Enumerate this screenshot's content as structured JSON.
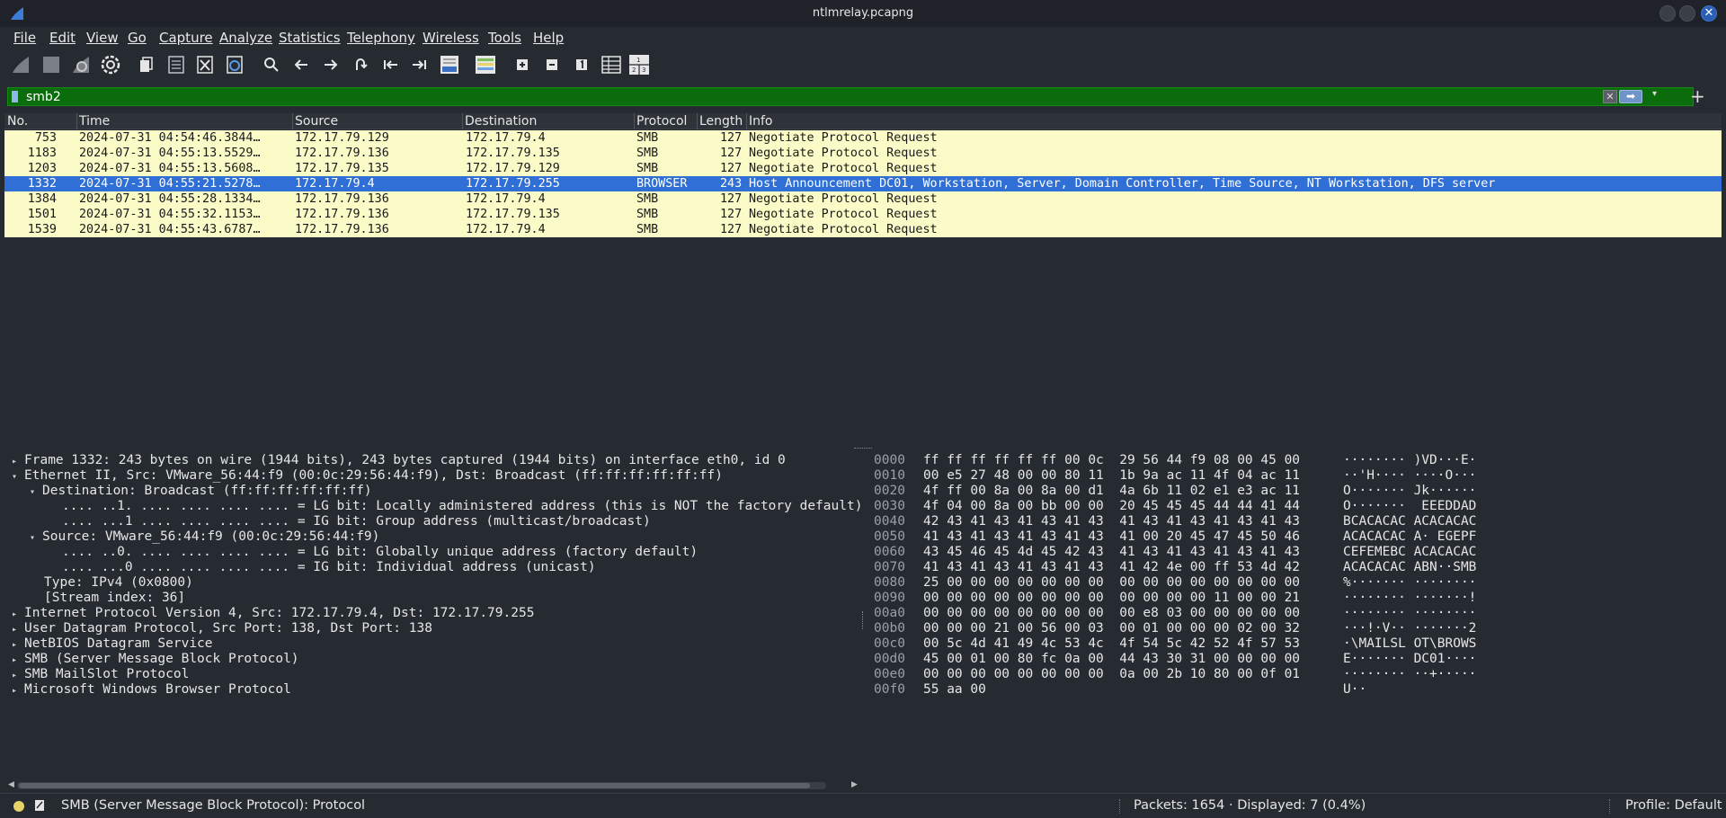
{
  "window": {
    "title": "ntlmrelay.pcapng",
    "app_icon": "wireshark-fin-icon",
    "close_glyph": "✕"
  },
  "menubar": {
    "items": [
      "File",
      "Edit",
      "View",
      "Go",
      "Capture",
      "Analyze",
      "Statistics",
      "Telephony",
      "Wireless",
      "Tools",
      "Help"
    ]
  },
  "toolbar": {
    "icons": [
      "start-capture-icon",
      "stop-capture-icon",
      "restart-capture-icon",
      "capture-options-icon",
      "open-file-icon",
      "save-file-icon",
      "close-file-icon",
      "reload-file-icon",
      "find-packet-icon",
      "go-back-icon",
      "go-forward-icon",
      "go-to-packet-icon",
      "first-packet-icon",
      "last-packet-icon",
      "auto-scroll-icon",
      "colorize-icon",
      "zoom-in-icon",
      "zoom-out-icon",
      "normal-size-icon",
      "resize-columns-icon",
      "layout-icon"
    ],
    "zoom_in_glyph": "+",
    "zoom_out_glyph": "−",
    "normal_size_glyph": "1",
    "layout_glyph": "1 2|3"
  },
  "filter": {
    "value": "smb2",
    "clear_glyph": "✕",
    "apply_glyph": "➡",
    "dropdown_glyph": "▾",
    "add_glyph": "+"
  },
  "packet_list": {
    "columns": [
      "No.",
      "Time",
      "Source",
      "Destination",
      "Protocol",
      "Length",
      "Info"
    ],
    "rows": [
      {
        "no": "753",
        "time": "2024-07-31 04:54:46.3844…",
        "src": "172.17.79.129",
        "dst": "172.17.79.4",
        "proto": "SMB",
        "len": "127",
        "info": "Negotiate Protocol Request"
      },
      {
        "no": "1183",
        "time": "2024-07-31 04:55:13.5529…",
        "src": "172.17.79.136",
        "dst": "172.17.79.135",
        "proto": "SMB",
        "len": "127",
        "info": "Negotiate Protocol Request"
      },
      {
        "no": "1203",
        "time": "2024-07-31 04:55:13.5608…",
        "src": "172.17.79.135",
        "dst": "172.17.79.129",
        "proto": "SMB",
        "len": "127",
        "info": "Negotiate Protocol Request"
      },
      {
        "no": "1332",
        "time": "2024-07-31 04:55:21.5278…",
        "src": "172.17.79.4",
        "dst": "172.17.79.255",
        "proto": "BROWSER",
        "len": "243",
        "info": "Host Announcement DC01, Workstation, Server, Domain Controller, Time Source, NT Workstation, DFS server"
      },
      {
        "no": "1384",
        "time": "2024-07-31 04:55:28.1334…",
        "src": "172.17.79.136",
        "dst": "172.17.79.4",
        "proto": "SMB",
        "len": "127",
        "info": "Negotiate Protocol Request"
      },
      {
        "no": "1501",
        "time": "2024-07-31 04:55:32.1153…",
        "src": "172.17.79.136",
        "dst": "172.17.79.135",
        "proto": "SMB",
        "len": "127",
        "info": "Negotiate Protocol Request"
      },
      {
        "no": "1539",
        "time": "2024-07-31 04:55:43.6787…",
        "src": "172.17.79.136",
        "dst": "172.17.79.4",
        "proto": "SMB",
        "len": "127",
        "info": "Negotiate Protocol Request"
      }
    ],
    "selected_row_no": "1332"
  },
  "details": {
    "arrow_collapsed": "▸",
    "arrow_expanded": "▾",
    "lines": [
      {
        "text": "Frame 1332: 243 bytes on wire (1944 bits), 243 bytes captured (1944 bits) on interface eth0, id 0",
        "arrow": "collapsed"
      },
      {
        "text": "Ethernet II, Src: VMware_56:44:f9 (00:0c:29:56:44:f9), Dst: Broadcast (ff:ff:ff:ff:ff:ff)",
        "arrow": "expanded"
      },
      {
        "text": "Destination: Broadcast (ff:ff:ff:ff:ff:ff)",
        "arrow": "expanded"
      },
      {
        "text": ".... ..1. .... .... .... .... = LG bit: Locally administered address (this is NOT the factory default)",
        "arrow": "none"
      },
      {
        "text": ".... ...1 .... .... .... .... = IG bit: Group address (multicast/broadcast)",
        "arrow": "none"
      },
      {
        "text": "Source: VMware_56:44:f9 (00:0c:29:56:44:f9)",
        "arrow": "expanded"
      },
      {
        "text": ".... ..0. .... .... .... .... = LG bit: Globally unique address (factory default)",
        "arrow": "none"
      },
      {
        "text": ".... ...0 .... .... .... .... = IG bit: Individual address (unicast)",
        "arrow": "none"
      },
      {
        "text": "Type: IPv4 (0x0800)",
        "arrow": "none"
      },
      {
        "text": "[Stream index: 36]",
        "arrow": "none"
      },
      {
        "text": "Internet Protocol Version 4, Src: 172.17.79.4, Dst: 172.17.79.255",
        "arrow": "collapsed"
      },
      {
        "text": "User Datagram Protocol, Src Port: 138, Dst Port: 138",
        "arrow": "collapsed"
      },
      {
        "text": "NetBIOS Datagram Service",
        "arrow": "collapsed"
      },
      {
        "text": "SMB (Server Message Block Protocol)",
        "arrow": "collapsed"
      },
      {
        "text": "SMB MailSlot Protocol",
        "arrow": "collapsed"
      },
      {
        "text": "Microsoft Windows Browser Protocol",
        "arrow": "collapsed"
      }
    ]
  },
  "bytes": {
    "rows": [
      {
        "off": "0000",
        "hex": "ff ff ff ff ff ff 00 0c  29 56 44 f9 08 00 45 00",
        "ascii": "········ )VD···E·"
      },
      {
        "off": "0010",
        "hex": "00 e5 27 48 00 00 80 11  1b 9a ac 11 4f 04 ac 11",
        "ascii": "··'H···· ····O···"
      },
      {
        "off": "0020",
        "hex": "4f ff 00 8a 00 8a 00 d1  4a 6b 11 02 e1 e3 ac 11",
        "ascii": "O······· Jk······"
      },
      {
        "off": "0030",
        "hex": "4f 04 00 8a 00 bb 00 00  20 45 45 45 44 44 41 44",
        "ascii": "O·······  EEEDDAD"
      },
      {
        "off": "0040",
        "hex": "42 43 41 43 41 43 41 43  41 43 41 43 41 43 41 43",
        "ascii": "BCACACAC ACACACAC"
      },
      {
        "off": "0050",
        "hex": "41 43 41 43 41 43 41 43  41 00 20 45 47 45 50 46",
        "ascii": "ACACACAC A· EGEPF"
      },
      {
        "off": "0060",
        "hex": "43 45 46 45 4d 45 42 43  41 43 41 43 41 43 41 43",
        "ascii": "CEFEMEBC ACACACAC"
      },
      {
        "off": "0070",
        "hex": "41 43 41 43 41 43 41 43  41 42 4e 00 ff 53 4d 42",
        "ascii": "ACACACAC ABN··SMB"
      },
      {
        "off": "0080",
        "hex": "25 00 00 00 00 00 00 00  00 00 00 00 00 00 00 00",
        "ascii": "%······· ········"
      },
      {
        "off": "0090",
        "hex": "00 00 00 00 00 00 00 00  00 00 00 00 11 00 00 21",
        "ascii": "········ ·······!"
      },
      {
        "off": "00a0",
        "hex": "00 00 00 00 00 00 00 00  00 e8 03 00 00 00 00 00",
        "ascii": "········ ········"
      },
      {
        "off": "00b0",
        "hex": "00 00 00 21 00 56 00 03  00 01 00 00 00 02 00 32",
        "ascii": "···!·V·· ·······2"
      },
      {
        "off": "00c0",
        "hex": "00 5c 4d 41 49 4c 53 4c  4f 54 5c 42 52 4f 57 53",
        "ascii": "·\\MAILSL OT\\BROWS"
      },
      {
        "off": "00d0",
        "hex": "45 00 01 00 80 fc 0a 00  44 43 30 31 00 00 00 00",
        "ascii": "E······· DC01····"
      },
      {
        "off": "00e0",
        "hex": "00 00 00 00 00 00 00 00  0a 00 2b 10 80 00 0f 01",
        "ascii": "········ ··+·····"
      },
      {
        "off": "00f0",
        "hex": "55 aa 00",
        "ascii": "U··"
      }
    ]
  },
  "statusbar": {
    "message": "SMB (Server Message Block Protocol): Protocol",
    "packets": "Packets: 1654 · Displayed: 7 (0.4%)",
    "profile": "Profile: Default",
    "expert_led_color": "#e6d36a"
  },
  "colors": {
    "background": "#262a31",
    "row_highlight": "#fbfbc8",
    "row_selected": "#2f6fd6",
    "filter_valid": "#0a6c0a"
  }
}
